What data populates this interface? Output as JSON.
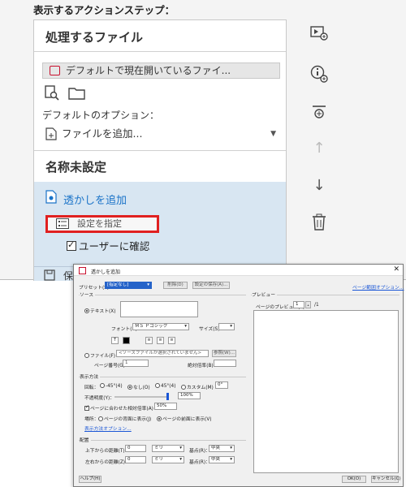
{
  "wizard": {
    "heading": "表示するアクションステップ：",
    "section1_title": "処理するファイル",
    "file_chip": "デフォルトで現在開いているファイ...",
    "default_options_label": "デフォルトのオプション：",
    "add_file_label": "ファイルを追加...",
    "section2_title": "名称未設定",
    "step_title": "透かしを追加",
    "setting_button": "設定を指定",
    "confirm_label": "ユーザーに確認",
    "partial_label": "保"
  },
  "dialog": {
    "title": "透かしを追加",
    "preset_label": "プリセット(S)：",
    "preset_value": "[指定なし]",
    "delete_btn": "削除(D)",
    "save_btn": "設定の保存(A)...",
    "page_range_link": "ページ範囲オプション...",
    "source_label": "ソース",
    "text_radio": "テキスト(X)",
    "font_label": "フォント(N)：",
    "font_value": "ＭＳ Ｐゴシック",
    "size_label": "サイズ(S)：",
    "bold_btn": "T",
    "align_left": "≡",
    "align_center": "≡",
    "align_right": "≡",
    "file_radio": "ファイル(F)",
    "file_value": "<ソースファイルが選択されていません>",
    "browse_btn": "参照(W)...",
    "page_num_label": "ページ番号(G)：",
    "page_num_value": "1",
    "abs_scale_label": "絶対倍率(B)：",
    "appearance_label": "表示方法",
    "rotation_label": "回転：",
    "rot_m45": "-45°(4)",
    "rot_none": "なし(O)",
    "rot_45": "45°(4)",
    "rot_custom": "カスタム(M)",
    "rot_custom_value": "0°",
    "opacity_label": "不透明度(Y)：",
    "opacity_value": "100%",
    "opacity_fraction": 1.0,
    "relative_scale_label": "ページに合わせた相対倍率(A)",
    "relative_scale_value": "50%",
    "location_label": "場所：",
    "behind_page": "ページの背面に表示(J)",
    "front_page": "ページの前面に表示(V)",
    "appearance_options_link": "表示方法オプション...",
    "position_label": "配置",
    "vertical_label": "上下からの距離(T)：",
    "vertical_value": "0",
    "vertical_unit": "ミリ",
    "from_label_v": "基点(R)：",
    "from_value_v": "中央",
    "horizontal_label": "左右からの距離(Z)：",
    "horizontal_value": "0",
    "horizontal_unit": "ミリ",
    "from_label_h": "基点(R)：",
    "from_value_h": "中央",
    "preview_label": "プレビュー",
    "preview_page_label": "ページのプレビュー(E)",
    "preview_page_value": "1",
    "preview_page_total": "/1",
    "help_btn": "ヘルプ(H)",
    "ok_btn": "OK(O)",
    "cancel_btn": "キャンセル(C)"
  }
}
